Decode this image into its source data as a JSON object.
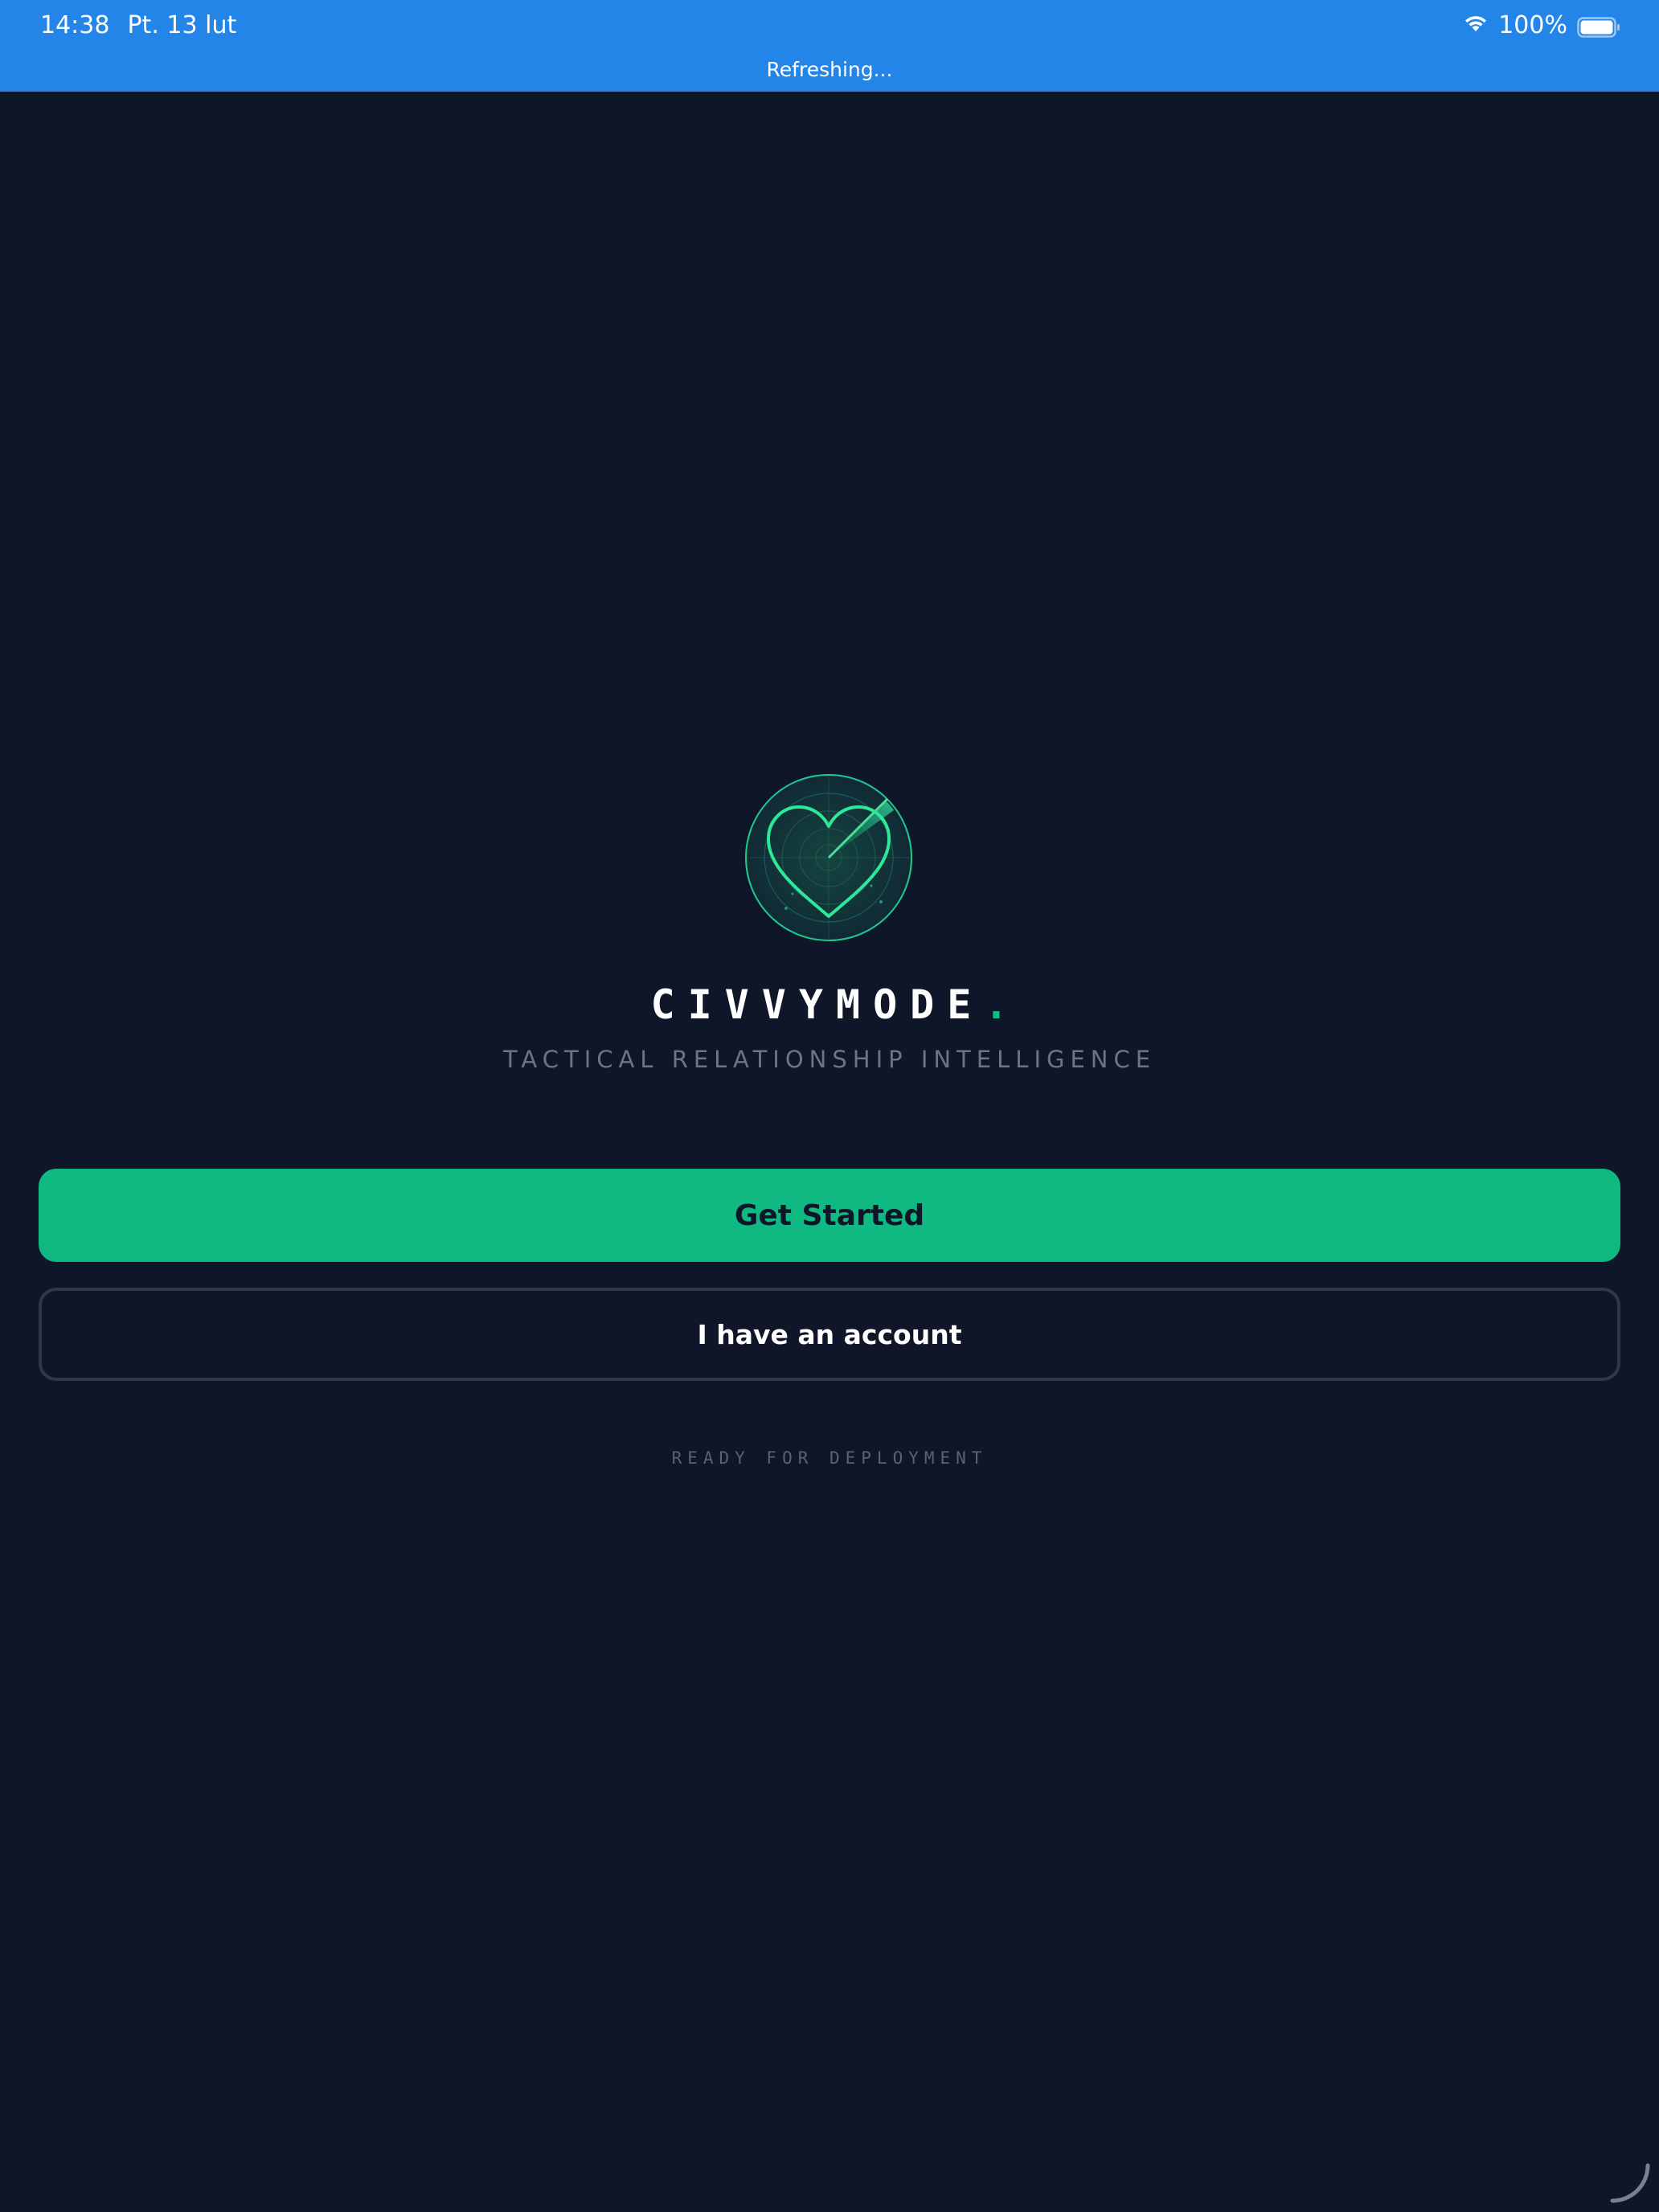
{
  "status_bar": {
    "time": "14:38",
    "date": "Pt. 13 lut",
    "battery_percent": "100%",
    "refresh_text": "Refreshing...",
    "wifi_icon": "wifi-icon",
    "battery_icon": "battery-full-icon",
    "background_color": "#2385e8"
  },
  "logo": {
    "icon": "radar-heart-icon",
    "accent_color": "#10b981"
  },
  "brand": {
    "name": "CIVVYMODE",
    "dot": ".",
    "tagline": "TACTICAL RELATIONSHIP INTELLIGENCE"
  },
  "actions": {
    "primary_label": "Get Started",
    "secondary_label": "I have an account"
  },
  "footer": {
    "status_text": "READY FOR DEPLOYMENT"
  },
  "loading": {
    "icon": "loading-spinner-icon"
  },
  "colors": {
    "background": "#0f1629",
    "accent": "#10b981",
    "muted_text": "#6b7585",
    "border": "#2e3849"
  }
}
